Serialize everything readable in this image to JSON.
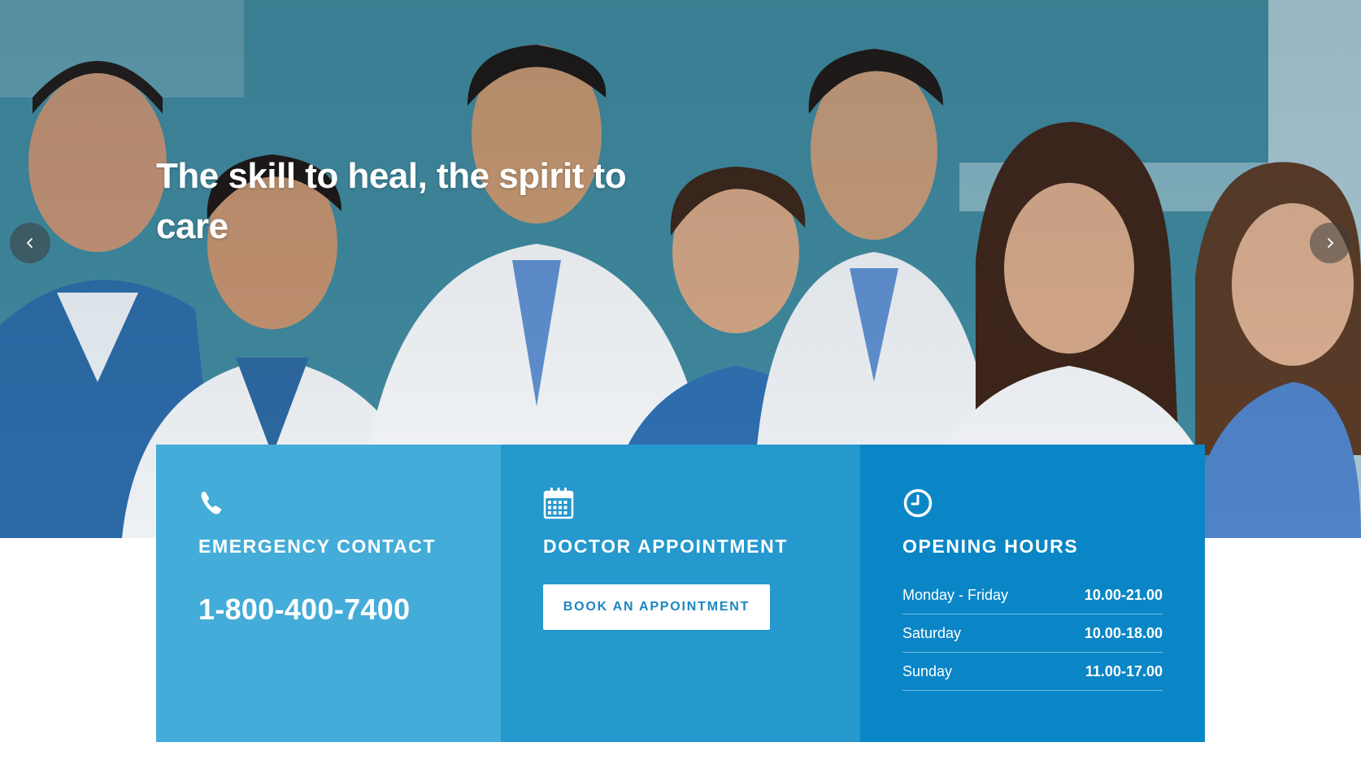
{
  "hero": {
    "title": "The skill to heal, the spirit to care",
    "prev_icon": "chevron-left-icon",
    "next_icon": "chevron-right-icon"
  },
  "emergency": {
    "icon": "phone-icon",
    "title": "EMERGENCY CONTACT",
    "phone": "1-800-400-7400",
    "color": "#44acd8"
  },
  "appointment": {
    "icon": "calendar-icon",
    "title": "DOCTOR APPOINTMENT",
    "button_label": "BOOK AN APPOINTMENT",
    "color": "#2598cd"
  },
  "hours": {
    "icon": "clock-icon",
    "title": "OPENING HOURS",
    "color": "#0a86c6",
    "rows": [
      {
        "day": "Monday - Friday",
        "time": "10.00-21.00"
      },
      {
        "day": "Saturday",
        "time": "10.00-18.00"
      },
      {
        "day": "Sunday",
        "time": "11.00-17.00"
      }
    ]
  }
}
